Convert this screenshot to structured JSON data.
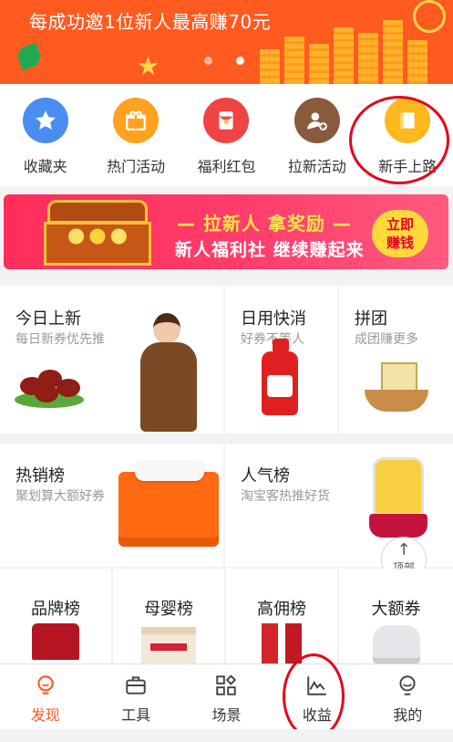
{
  "banner": {
    "headline": "每成功邀1位新人最高赚70元",
    "carousel_count": 2,
    "active_index": 1
  },
  "quick_menu": [
    {
      "label": "收藏夹",
      "icon": "star-icon",
      "color": "#4a8df0"
    },
    {
      "label": "热门活动",
      "icon": "gift-icon",
      "color": "#ffa21f"
    },
    {
      "label": "福利红包",
      "icon": "red-envelope-icon",
      "color": "#f04343"
    },
    {
      "label": "拉新活动",
      "icon": "add-user-icon",
      "color": "#8a5a3c"
    },
    {
      "label": "新手上路",
      "icon": "book-icon",
      "color": "#ffb81e"
    }
  ],
  "promo": {
    "line1": "— 拉新人 拿奖励 —",
    "line2": "新人福利社 继续赚起来",
    "cta_line1": "立即",
    "cta_line2": "赚钱"
  },
  "grid_row1": [
    {
      "title": "今日上新",
      "subtitle": "每日新券优先推"
    },
    {
      "title": "日用快消",
      "subtitle": "好券不等人"
    },
    {
      "title": "拼团",
      "subtitle": "成团赚更多"
    }
  ],
  "grid_row2": [
    {
      "title": "热销榜",
      "subtitle": "聚划算大额好券"
    },
    {
      "title": "人气榜",
      "subtitle": "淘宝客热推好货"
    }
  ],
  "grid_row3": [
    {
      "title": "品牌榜"
    },
    {
      "title": "母婴榜"
    },
    {
      "title": "高佣榜"
    },
    {
      "title": "大额券"
    }
  ],
  "back_to_top": {
    "label": "顶部"
  },
  "tabbar": [
    {
      "label": "发现",
      "icon": "bulb-icon",
      "active": true
    },
    {
      "label": "工具",
      "icon": "briefcase-icon",
      "active": false
    },
    {
      "label": "场景",
      "icon": "grid-icon",
      "active": false
    },
    {
      "label": "收益",
      "icon": "chart-line-icon",
      "active": false
    },
    {
      "label": "我的",
      "icon": "profile-icon",
      "active": false
    }
  ],
  "colors": {
    "brand": "#ff5a1f",
    "annotation": "#e8001c"
  }
}
